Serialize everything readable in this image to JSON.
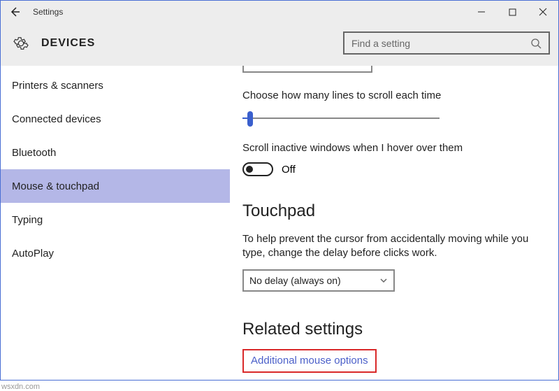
{
  "window": {
    "title": "Settings",
    "section": "DEVICES"
  },
  "search": {
    "placeholder": "Find a setting"
  },
  "sidebar": {
    "items": [
      {
        "label": "Printers & scanners",
        "selected": false
      },
      {
        "label": "Connected devices",
        "selected": false
      },
      {
        "label": "Bluetooth",
        "selected": false
      },
      {
        "label": "Mouse & touchpad",
        "selected": true
      },
      {
        "label": "Typing",
        "selected": false
      },
      {
        "label": "AutoPlay",
        "selected": false
      }
    ]
  },
  "content": {
    "scroll_lines_label": "Choose how many lines to scroll each time",
    "scroll_lines_slider_percent": 4,
    "inactive_scroll_label": "Scroll inactive windows when I hover over them",
    "inactive_scroll_state": "Off",
    "touchpad_heading": "Touchpad",
    "touchpad_body": "To help prevent the cursor from accidentally moving while you type, change the delay before clicks work.",
    "touchpad_delay_selected": "No delay (always on)",
    "related_heading": "Related settings",
    "related_link": "Additional mouse options"
  },
  "watermark": "wsxdn.com"
}
